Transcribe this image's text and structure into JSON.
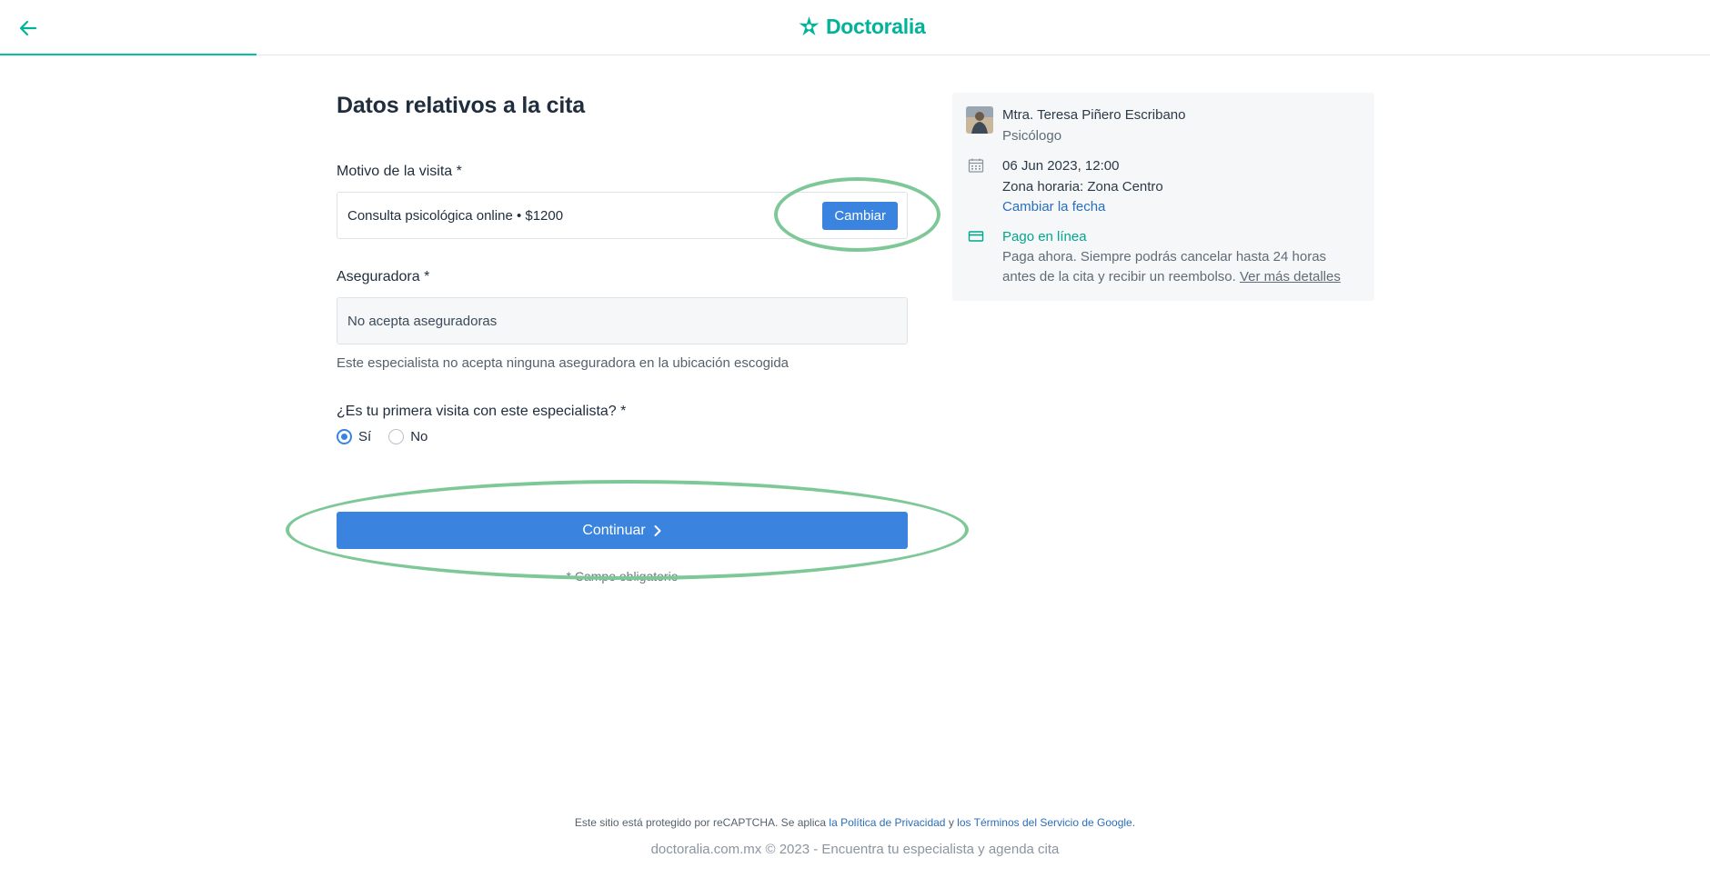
{
  "header": {
    "logo_text": "Doctoralia",
    "progress_fraction": 0.15,
    "brand_color": "#00b39b"
  },
  "form": {
    "title": "Datos relativos a la cita",
    "reason": {
      "label": "Motivo de la visita *",
      "value": "Consulta psicológica online • $1200",
      "change_button": "Cambiar"
    },
    "insurer": {
      "label": "Aseguradora *",
      "value": "No acepta aseguradoras",
      "hint": "Este especialista no acepta ninguna aseguradora en la ubicación escogida"
    },
    "first_visit": {
      "label": "¿Es tu primera visita con este especialista? *",
      "options": [
        {
          "label": "Sí",
          "selected": true
        },
        {
          "label": "No",
          "selected": false
        }
      ]
    },
    "continue_button": "Continuar",
    "required_note": "* Campo obligatorio"
  },
  "summary": {
    "doctor_name": "Mtra. Teresa Piñero Escribano",
    "doctor_role": "Psicólogo",
    "datetime": "06 Jun 2023, 12:00",
    "timezone": "Zona horaria: Zona Centro",
    "change_date_link": "Cambiar la fecha",
    "payment_title": "Pago en línea",
    "payment_text": "Paga ahora. Siempre podrás cancelar hasta 24 horas antes de la cita y recibir un reembolso.",
    "payment_link": "Ver más detalles"
  },
  "footer": {
    "recaptcha_prefix": "Este sitio está protegido por reCAPTCHA. Se aplica",
    "privacy_link": "la Política de Privacidad",
    "and": "y",
    "terms_link": "los Términos del Servicio de Google",
    "period": ".",
    "copyright": "doctoralia.com.mx © 2023 - Encuentra tu especialista y agenda cita"
  },
  "colors": {
    "primary_button": "#3a84df",
    "annotation_ellipse": "#7ec897"
  }
}
